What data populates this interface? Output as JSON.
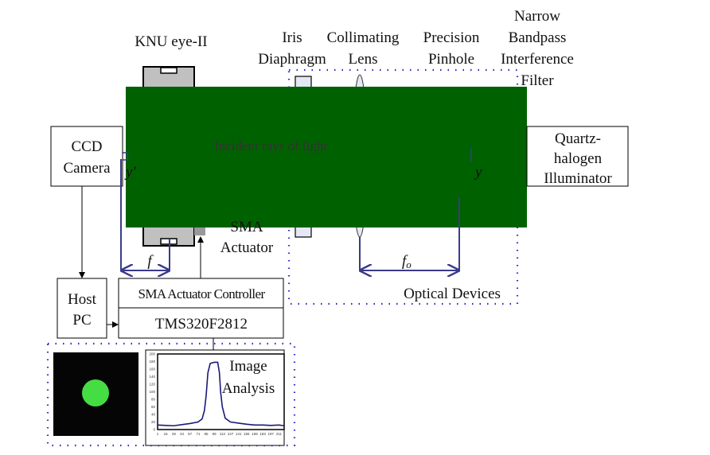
{
  "labels": {
    "knu_eye": "KNU eye-II",
    "iris": [
      "Iris",
      "Diaphragm"
    ],
    "collimating_lens": [
      "Collimating",
      "Lens"
    ],
    "pinhole": [
      "Precision",
      "Pinhole"
    ],
    "filter": [
      "Narrow",
      "Bandpass",
      "Interference",
      "Filter"
    ],
    "ccd": [
      "CCD",
      "Camera"
    ],
    "illuminator": [
      "Quartz-",
      "halogen",
      "Illuminator"
    ],
    "incident_rays": "Incident rays of light",
    "y_prime": "y'",
    "y": "y",
    "sma_actuator": [
      "SMA",
      "Actuator"
    ],
    "f": "f",
    "fo": "f",
    "fo_sub": "o",
    "optical_devices": "Optical Devices",
    "host_pc": [
      "Host",
      "PC"
    ],
    "sma_controller": "SMA Actuator Controller",
    "tms": "TMS320F2812",
    "image_analysis": [
      "Image",
      "Analysis"
    ]
  },
  "colors": {
    "overlay": "#006100",
    "dimension_lines": "#3a3a8a",
    "dotted_border": "#2a2acc",
    "spot": "#44dd44"
  },
  "inset_plot": {
    "y_ticks": [
      "0",
      "20",
      "40",
      "60",
      "80",
      "100",
      "120",
      "140",
      "160",
      "180",
      "200"
    ],
    "x_ticks": [
      "1",
      "15",
      "29",
      "43",
      "57",
      "71",
      "85",
      "99",
      "113",
      "127",
      "141",
      "155",
      "169",
      "183",
      "197",
      "211"
    ],
    "ylim": [
      0,
      200
    ],
    "xlim": [
      1,
      220
    ],
    "profile": [
      [
        1,
        12
      ],
      [
        15,
        11
      ],
      [
        29,
        10
      ],
      [
        43,
        13
      ],
      [
        57,
        16
      ],
      [
        71,
        20
      ],
      [
        78,
        28
      ],
      [
        82,
        50
      ],
      [
        85,
        90
      ],
      [
        88,
        150
      ],
      [
        92,
        175
      ],
      [
        99,
        178
      ],
      [
        105,
        178
      ],
      [
        108,
        150
      ],
      [
        110,
        100
      ],
      [
        113,
        60
      ],
      [
        118,
        30
      ],
      [
        127,
        20
      ],
      [
        141,
        17
      ],
      [
        155,
        14
      ],
      [
        169,
        12
      ],
      [
        183,
        12
      ],
      [
        197,
        11
      ],
      [
        211,
        12
      ],
      [
        220,
        10
      ]
    ]
  }
}
